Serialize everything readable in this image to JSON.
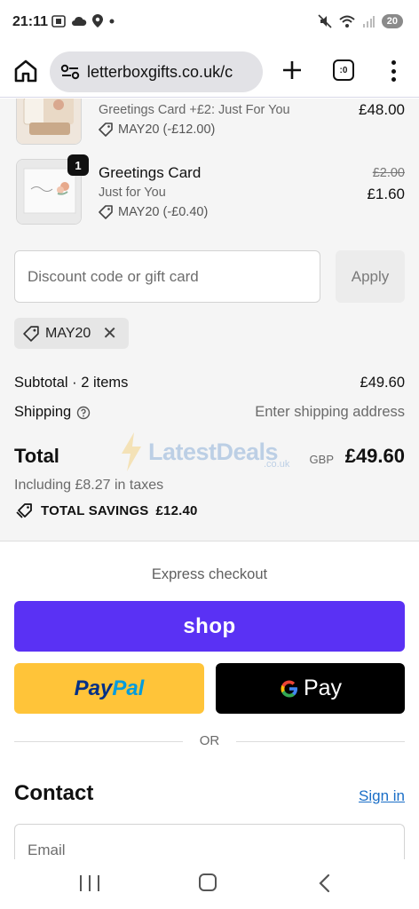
{
  "status_bar": {
    "time": "21:11",
    "battery": "20"
  },
  "browser": {
    "url": "letterboxgifts.co.uk/c",
    "tab_count": ":0"
  },
  "order_items": [
    {
      "title": "",
      "subtitle": "Greetings Card +£2: Just For You",
      "discount": "MAY20 (-£12.00)",
      "price": "£48.00",
      "old_price": ""
    },
    {
      "quantity": "1",
      "title": "Greetings Card",
      "subtitle": "Just for You",
      "discount": "MAY20 (-£0.40)",
      "price": "£1.60",
      "old_price": "£2.00"
    }
  ],
  "discount": {
    "placeholder": "Discount code or gift card",
    "apply_label": "Apply",
    "applied_code": "MAY20"
  },
  "totals": {
    "subtotal_label": "Subtotal · 2 items",
    "subtotal_value": "£49.60",
    "shipping_label": "Shipping",
    "shipping_value": "Enter shipping address",
    "total_label": "Total",
    "currency": "GBP",
    "total_value": "£49.60",
    "tax_line": "Including £8.27 in taxes",
    "savings_label": "TOTAL SAVINGS",
    "savings_value": "£12.40"
  },
  "watermark": {
    "text": "LatestDeals",
    "sub": ".co.uk"
  },
  "checkout": {
    "express_label": "Express checkout",
    "shop_label": "shop",
    "paypal_pay": "Pay",
    "paypal_pal": "Pal",
    "gpay_label": "Pay",
    "or_label": "OR",
    "contact_heading": "Contact",
    "signin_label": "Sign in",
    "email_placeholder": "Email"
  },
  "colors": {
    "shop_purple": "#5a31f4",
    "paypal_yellow": "#ffc439",
    "link_blue": "#1a6ec7"
  }
}
